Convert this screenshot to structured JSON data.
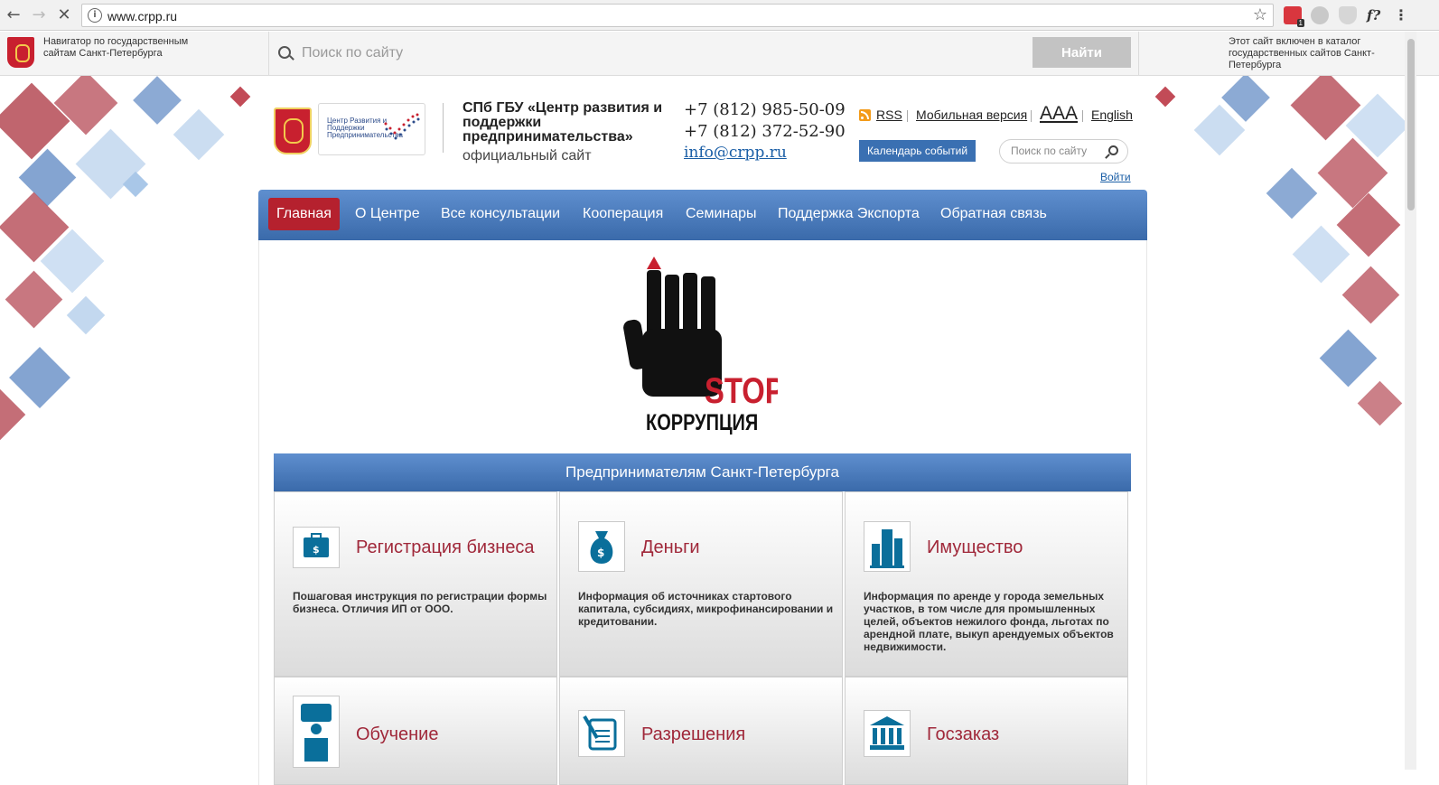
{
  "browser": {
    "back": "←",
    "forward": "→",
    "reload": "✕",
    "url": "www.crpp.ru",
    "star": "☆",
    "ext_badge": "1",
    "ext_f": "f?",
    "menu": "⋮"
  },
  "spb_bar": {
    "navigator_text": "Навигатор по государственным сайтам Санкт-Петербурга",
    "search_placeholder": "Поиск по сайту",
    "find_button": "Найти",
    "catalog_text": "Этот сайт включен в каталог государственных сайтов Санкт-Петербурга"
  },
  "header": {
    "logo_text": "Центр Развития и Поддержки Предпринимательства",
    "org_name": "СПб ГБУ «Центр развития и поддержки предпринимательства»",
    "org_sub": "официальный сайт",
    "phone1": "+7 (812) 985-50-09",
    "phone2": "+7 (812) 372-52-90",
    "email": "info@crpp.ru",
    "links": {
      "rss": "RSS",
      "mobile": "Мобильная версия",
      "aaa": "AAA",
      "english": "English"
    },
    "calendar_button": "Календарь событий",
    "search_placeholder": "Поиск по сайту",
    "login": "Войти"
  },
  "nav": {
    "items": [
      "Главная",
      "О Центре",
      "Все консультации",
      "Кооперация",
      "Семинары",
      "Поддержка Экспорта",
      "Обратная связь"
    ],
    "active_index": 0
  },
  "banner_image": {
    "stop": "STOP",
    "corruption": "КОРРУПЦИЯ"
  },
  "section": {
    "title": "Предпринимателям Санкт-Петербурга",
    "tiles": [
      {
        "icon": "briefcase-icon",
        "title": "Регистрация бизнеса",
        "desc": "Пошаговая инструкция по регистрации формы бизнеса. Отличия ИП от ООО."
      },
      {
        "icon": "money-bag-icon",
        "title": "Деньги",
        "desc": "Информация об источниках стартового капитала, субсидиях, микрофинансировании и кредитовании."
      },
      {
        "icon": "buildings-icon",
        "title": "Имущество",
        "desc": "Информация по аренде у города земельных участков, в том числе для промышленных целей, объектов нежилого фонда, льготах по арендной плате, выкуп арендуемых объектов недвижимости."
      },
      {
        "icon": "lecturer-icon",
        "title": "Обучение",
        "desc": ""
      },
      {
        "icon": "document-pen-icon",
        "title": "Разрешения",
        "desc": ""
      },
      {
        "icon": "bank-icon",
        "title": "Госзаказ",
        "desc": ""
      }
    ]
  },
  "colors": {
    "nav_blue": "#3a6aaa",
    "active_red": "#b5212e",
    "tile_title": "#a0283a",
    "icon_teal": "#0a6f9b"
  }
}
